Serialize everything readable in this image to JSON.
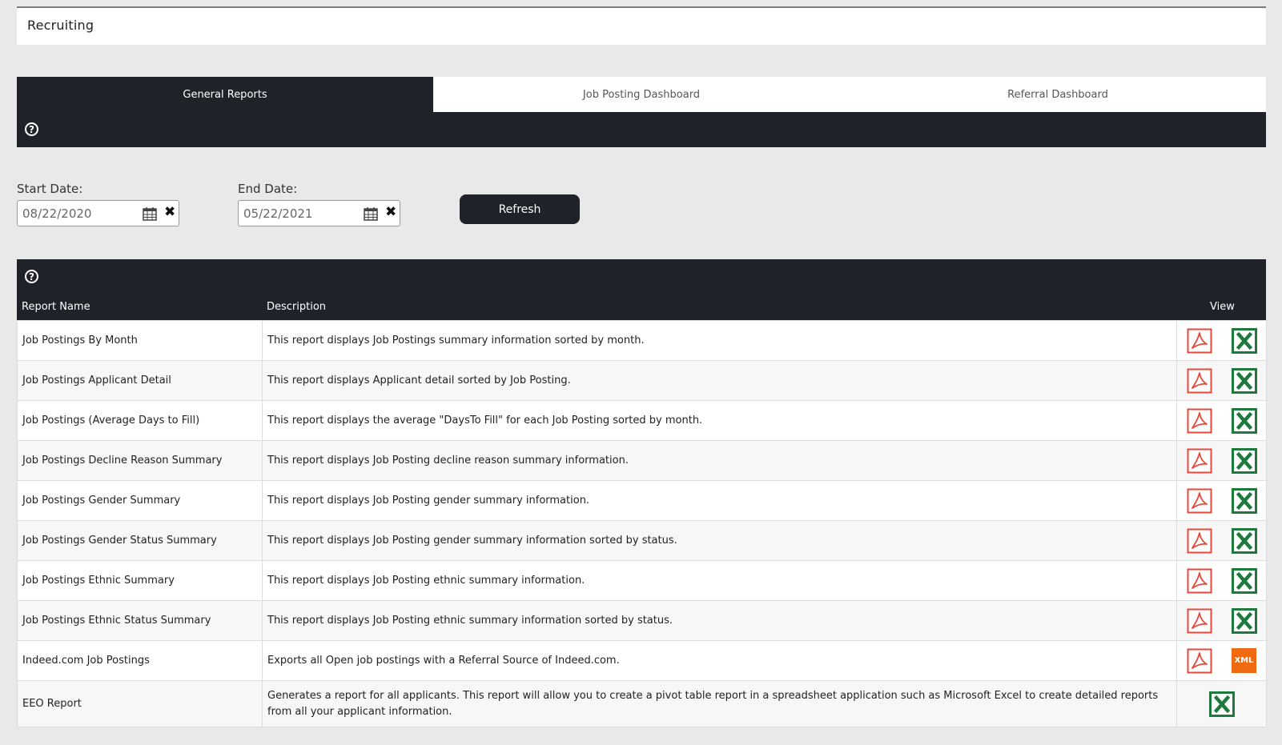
{
  "page": {
    "title": "Recruiting"
  },
  "tabs": [
    {
      "label": "General Reports",
      "active": true
    },
    {
      "label": "Job Posting Dashboard",
      "active": false
    },
    {
      "label": "Referral Dashboard",
      "active": false
    }
  ],
  "filters": {
    "start_label": "Start Date:",
    "start_value": "08/22/2020",
    "end_label": "End Date:",
    "end_value": "05/22/2021",
    "refresh_label": "Refresh"
  },
  "table": {
    "headers": {
      "name": "Report Name",
      "description": "Description",
      "view": "View"
    },
    "rows": [
      {
        "name": "Job Postings By Month",
        "description": "This report displays Job Postings summary information sorted by month.",
        "icons": [
          "pdf-icon",
          "excel-icon"
        ]
      },
      {
        "name": "Job Postings Applicant Detail",
        "description": "This report displays Applicant detail sorted by Job Posting.",
        "icons": [
          "pdf-icon",
          "excel-icon"
        ]
      },
      {
        "name": "Job Postings (Average Days to Fill)",
        "description": "This report displays the average \"DaysTo Fill\" for each Job Posting sorted by month.",
        "icons": [
          "pdf-icon",
          "excel-icon"
        ]
      },
      {
        "name": "Job Postings Decline Reason Summary",
        "description": "This report displays Job Posting decline reason summary information.",
        "icons": [
          "pdf-icon",
          "excel-icon"
        ]
      },
      {
        "name": "Job Postings Gender Summary",
        "description": "This report displays Job Posting gender summary information.",
        "icons": [
          "pdf-icon",
          "excel-icon"
        ]
      },
      {
        "name": "Job Postings Gender Status Summary",
        "description": "This report displays Job Posting gender summary information sorted by status.",
        "icons": [
          "pdf-icon",
          "excel-icon"
        ]
      },
      {
        "name": "Job Postings Ethnic Summary",
        "description": "This report displays Job Posting ethnic summary information.",
        "icons": [
          "pdf-icon",
          "excel-icon"
        ]
      },
      {
        "name": "Job Postings Ethnic Status Summary",
        "description": "This report displays Job Posting ethnic summary information sorted by status.",
        "icons": [
          "pdf-icon",
          "excel-icon"
        ]
      },
      {
        "name": "Indeed.com Job Postings",
        "description": "Exports all Open job postings with a Referral Source of Indeed.com.",
        "icons": [
          "pdf-icon",
          "xml-icon"
        ],
        "xml_label": "XML"
      },
      {
        "name": "EEO Report",
        "description": "Generates a report for all applicants. This report will allow you to create a pivot table report in a spreadsheet application such as Microsoft Excel to create detailed reports from all your applicant information.",
        "icons": [
          "excel-icon"
        ]
      }
    ]
  },
  "colors": {
    "dark": "#1f2329",
    "background": "#e9e9e9",
    "pdf_red": "#e8483a",
    "excel_green": "#1e7a3c",
    "xml_orange": "#f06a12"
  }
}
